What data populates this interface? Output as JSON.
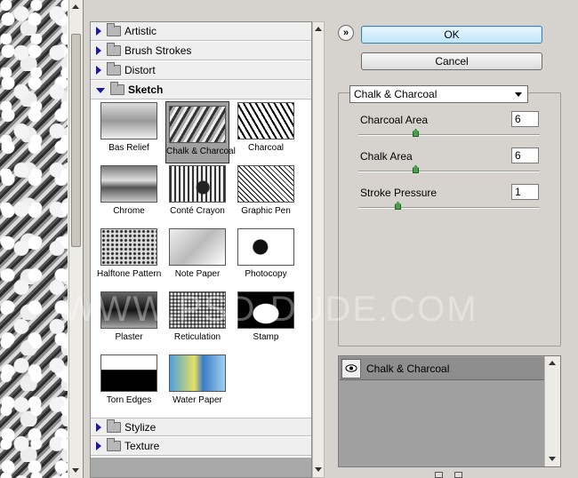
{
  "gallery": {
    "categories_top": [
      "Artistic",
      "Brush Strokes",
      "Distort",
      "Sketch"
    ],
    "categories_bottom": [
      "Stylize",
      "Texture"
    ],
    "thumbnails": [
      "Bas Relief",
      "Chalk & Charcoal",
      "Charcoal",
      "Chrome",
      "Conté Crayon",
      "Graphic Pen",
      "Halftone Pattern",
      "Note Paper",
      "Photocopy",
      "Plaster",
      "Reticulation",
      "Stamp",
      "Torn Edges",
      "Water Paper"
    ],
    "selected": "Chalk & Charcoal"
  },
  "buttons": {
    "ok": "OK",
    "cancel": "Cancel",
    "collapse_glyph": "»"
  },
  "settings": {
    "filter_selected": "Chalk & Charcoal",
    "params": [
      {
        "label": "Charcoal Area",
        "value": "6",
        "level_fraction": 0.3
      },
      {
        "label": "Chalk Area",
        "value": "6",
        "level_fraction": 0.3
      },
      {
        "label": "Stroke Pressure",
        "value": "1",
        "level_fraction": 0.2
      }
    ]
  },
  "layers": {
    "items": [
      {
        "name": "Chalk & Charcoal",
        "icon": "eye-icon"
      }
    ]
  },
  "watermark": "WWW.PSD-DUDE.COM",
  "colors": {
    "ok_accent": "#3c7fb1",
    "selected_thumb": "#a0a0a0",
    "slider_knob": "#4aa04a",
    "disclosure": "#1a1a9a"
  }
}
